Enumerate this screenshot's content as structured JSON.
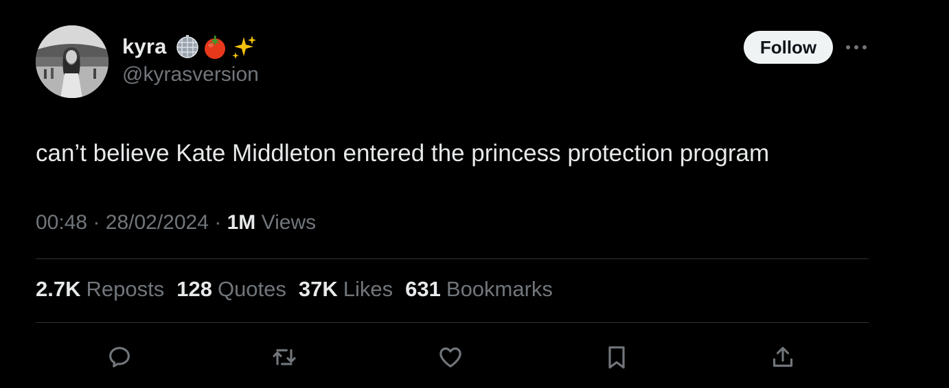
{
  "author": {
    "name": "kyra",
    "emojis": [
      "disco-ball-icon",
      "tomato-icon",
      "sparkles-icon"
    ],
    "handle": "@kyrasversion"
  },
  "follow_label": "Follow",
  "tweet": {
    "text": "can’t believe Kate Middleton entered the princess protection program"
  },
  "meta": {
    "time": "00:48",
    "date": "28/02/2024",
    "views_count": "1M",
    "views_label": "Views",
    "separator": "·"
  },
  "stats": [
    {
      "count": "2.7K",
      "label": "Reposts"
    },
    {
      "count": "128",
      "label": "Quotes"
    },
    {
      "count": "37K",
      "label": "Likes"
    },
    {
      "count": "631",
      "label": "Bookmarks"
    }
  ],
  "actions": [
    "reply-icon",
    "repost-icon",
    "like-icon",
    "bookmark-icon",
    "share-icon"
  ],
  "colors": {
    "background": "#000000",
    "primary_text": "#e7e9ea",
    "secondary_text": "#71767b",
    "divider": "#2f3336",
    "follow_bg": "#eff3f4"
  }
}
